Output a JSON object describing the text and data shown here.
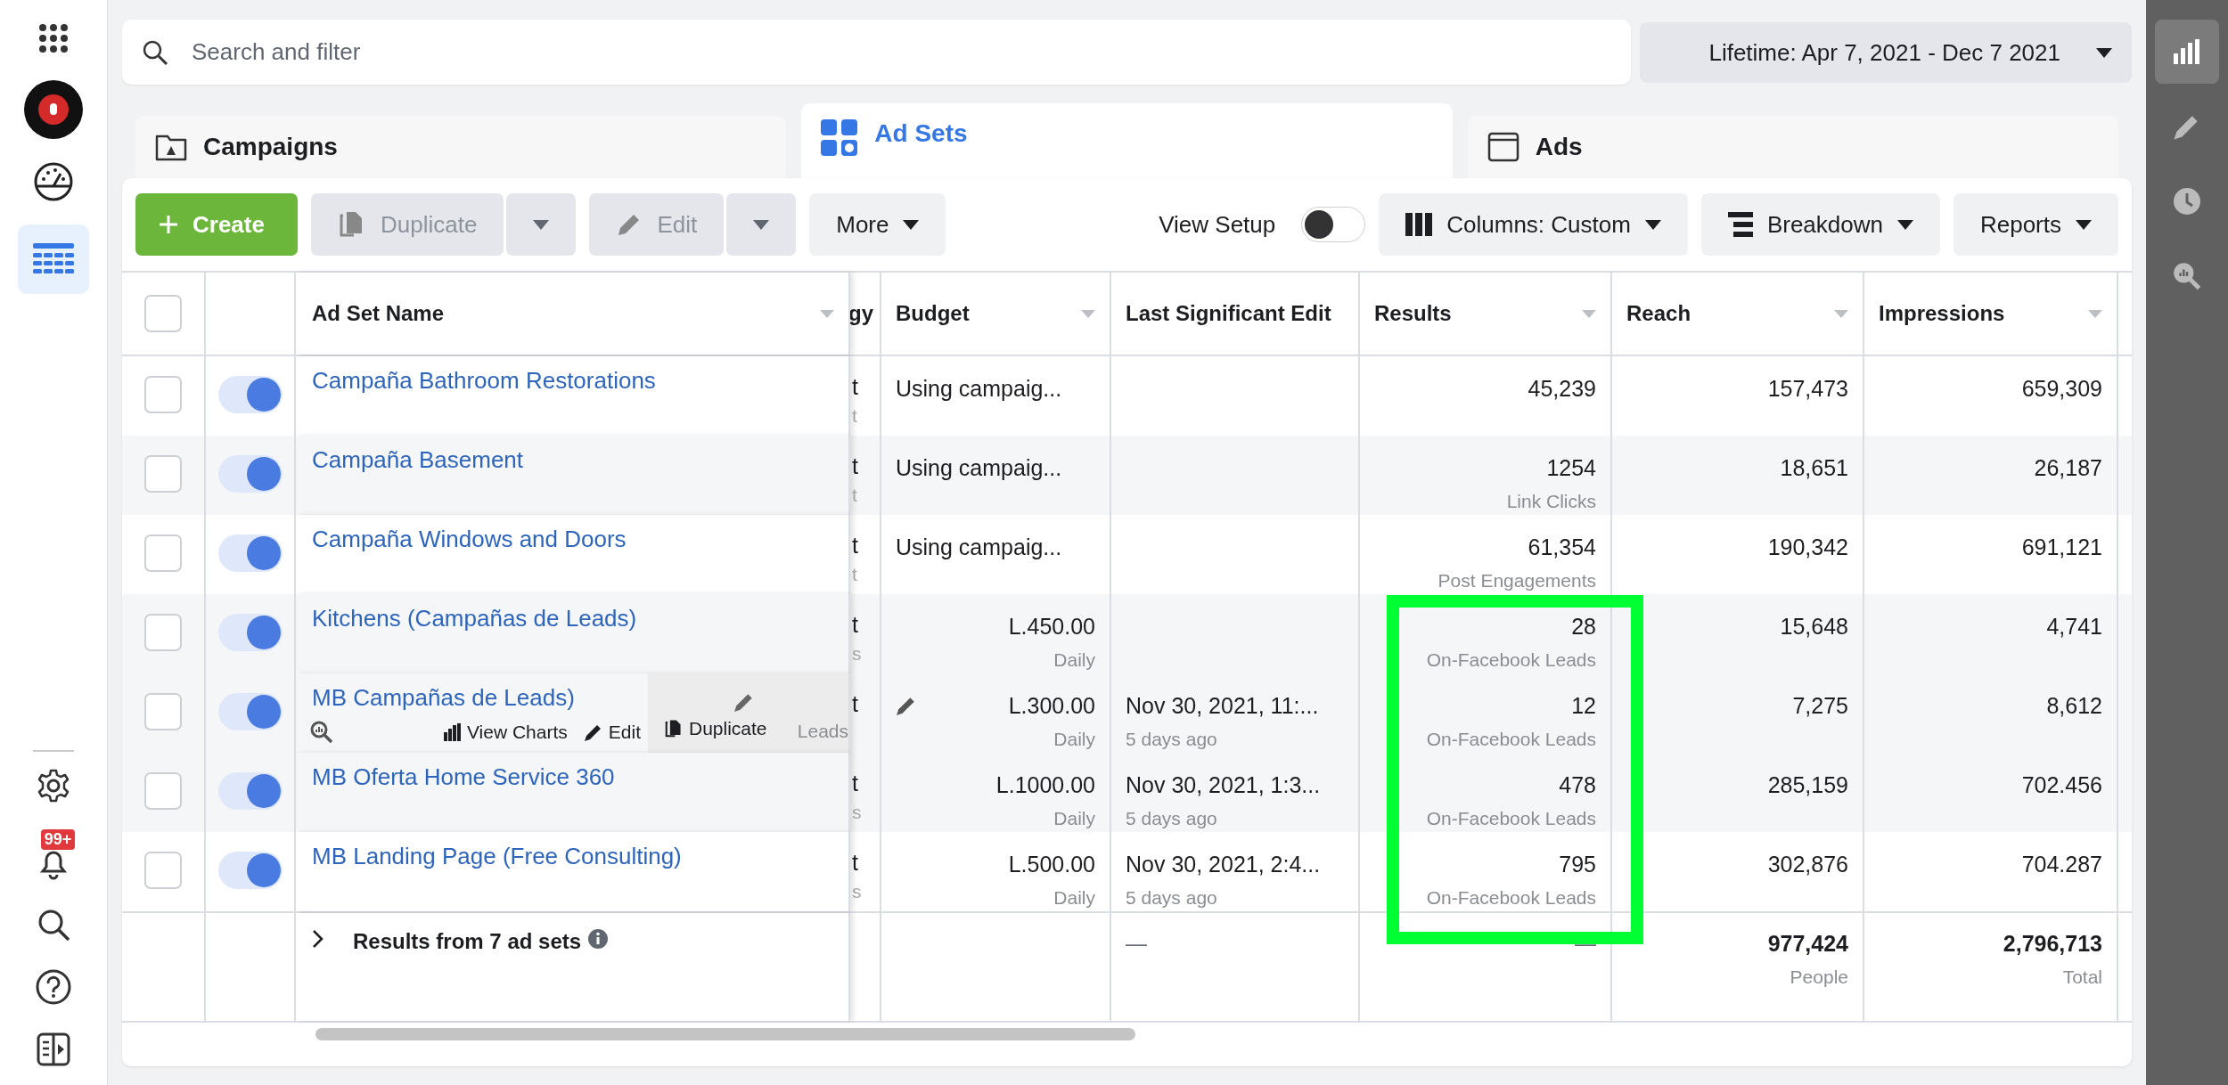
{
  "left_nav": [
    {
      "kind": "apps",
      "selected": false
    },
    {
      "kind": "account",
      "selected": false
    },
    {
      "kind": "gauge",
      "selected": false
    },
    {
      "kind": "table",
      "selected": true
    },
    {
      "kind": "settings",
      "selected": false
    },
    {
      "kind": "notifications",
      "selected": false,
      "badge": "99+"
    },
    {
      "kind": "search",
      "selected": false
    },
    {
      "kind": "help",
      "selected": false
    },
    {
      "kind": "panel",
      "selected": false
    }
  ],
  "search": {
    "placeholder": "Search and filter"
  },
  "date_range": {
    "label": "Lifetime: Apr 7, 2021 - Dec 7 2021"
  },
  "tabs": [
    {
      "kind": "campaigns",
      "label": "Campaigns",
      "selected": false
    },
    {
      "kind": "adsets",
      "label": "Ad Sets",
      "selected": true
    },
    {
      "kind": "ads",
      "label": "Ads",
      "selected": false
    }
  ],
  "toolbar": {
    "create": "Create",
    "duplicate": {
      "label": "Duplicate",
      "disabled": true
    },
    "edit": {
      "label": "Edit",
      "disabled": true
    },
    "more": "More",
    "view_setup": {
      "label": "View Setup",
      "on": false
    },
    "columns": "Columns: Custom",
    "breakdown": "Breakdown",
    "reports": "Reports"
  },
  "table": {
    "select_all_checked": false,
    "columns": [
      {
        "label": "Ad Set Name",
        "menu": true
      },
      {
        "label": "gy",
        "menu": false
      },
      {
        "label": "Budget",
        "menu": true
      },
      {
        "label": "Last Significant Edit",
        "menu": false
      },
      {
        "label": "Results",
        "menu": true
      },
      {
        "label": "Reach",
        "menu": true
      },
      {
        "label": "Impressions",
        "menu": true
      }
    ],
    "rows": [
      {
        "name": "Campaña Bathroom Restorations",
        "checked": false,
        "on": true,
        "hovered": false,
        "column_2": {
          "value": "t",
          "sub": "t"
        },
        "budget": {
          "value": "Using campaig..."
        },
        "results": {
          "value": "45,239"
        },
        "reach": "157,473",
        "impressions": "659,309"
      },
      {
        "name": "Campaña Basement",
        "checked": false,
        "on": true,
        "hovered": false,
        "column_2": {
          "value": "t",
          "sub": "t"
        },
        "budget": {
          "value": "Using campaig..."
        },
        "results": {
          "value": "1254",
          "sub": "Link Clicks"
        },
        "reach": "18,651",
        "impressions": "26,187"
      },
      {
        "name": "Campaña Windows and Doors",
        "checked": false,
        "on": true,
        "hovered": false,
        "column_2": {
          "value": "t",
          "sub": "t"
        },
        "budget": {
          "value": "Using campaig..."
        },
        "results": {
          "value": "61,354",
          "sub": "Post Engagements"
        },
        "reach": "190,342",
        "impressions": "691,121"
      },
      {
        "name": "Kitchens (Campañas de Leads)",
        "checked": false,
        "on": true,
        "hovered": false,
        "column_2": {
          "value": "t",
          "sub": "s"
        },
        "budget": {
          "value": "L.450.00",
          "sub": "Daily"
        },
        "results": {
          "value": "28",
          "sub": "On-Facebook Leads"
        },
        "reach": "15,648",
        "impressions": "4,741"
      },
      {
        "name": "MB Campañas de Leads)",
        "checked": false,
        "on": true,
        "hovered": true,
        "hover_actions": [
          "View Charts",
          "Edit",
          "Duplicate"
        ],
        "column_2": {
          "value": "t",
          "sub": "Leads"
        },
        "budget": {
          "value": "L.300.00",
          "sub": "Daily"
        },
        "last_edit": {
          "value": "Nov 30, 2021, 11:...",
          "sub": "5 days ago"
        },
        "results": {
          "value": "12",
          "sub": "On-Facebook Leads"
        },
        "reach": "7,275",
        "impressions": "8,612"
      },
      {
        "name": "MB Oferta Home Service 360",
        "checked": false,
        "on": true,
        "hovered": false,
        "column_2": {
          "value": "t",
          "sub": "s"
        },
        "budget": {
          "value": "L.1000.00",
          "sub": "Daily"
        },
        "last_edit": {
          "value": "Nov 30, 2021, 1:3...",
          "sub": "5 days ago"
        },
        "results": {
          "value": "478",
          "sub": "On-Facebook Leads"
        },
        "reach": "285,159",
        "impressions": "702.456"
      },
      {
        "name": "MB Landing Page (Free Consulting)",
        "checked": false,
        "on": true,
        "hovered": false,
        "column_2": {
          "value": "t",
          "sub": "s"
        },
        "budget": {
          "value": "L.500.00",
          "sub": "Daily"
        },
        "last_edit": {
          "value": "Nov 30, 2021, 2:4...",
          "sub": "5 days ago"
        },
        "results": {
          "value": "795",
          "sub": "On-Facebook Leads"
        },
        "reach": "302,876",
        "impressions": "704.287"
      }
    ],
    "footer": {
      "label": "Results from 7 ad sets",
      "last_edit": "—",
      "results": "—",
      "reach": {
        "value": "977,424",
        "sub": "People"
      },
      "impressions": {
        "value": "2,796,713",
        "sub": "Total"
      }
    }
  },
  "right_bar": [
    {
      "kind": "chart",
      "selected": true
    },
    {
      "kind": "pencil",
      "selected": false
    },
    {
      "kind": "clock",
      "selected": false
    },
    {
      "kind": "inspect",
      "selected": false
    }
  ]
}
